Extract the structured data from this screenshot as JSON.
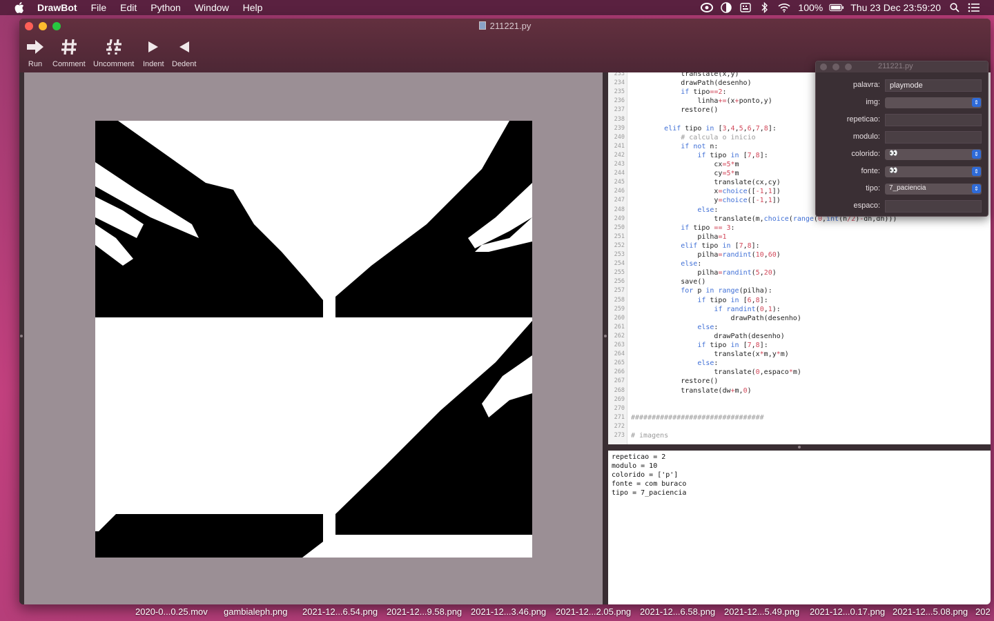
{
  "menubar": {
    "app": "DrawBot",
    "menus": [
      "File",
      "Edit",
      "Python",
      "Window",
      "Help"
    ],
    "battery": "100%",
    "clock": "Thu 23 Dec  23:59:20"
  },
  "window": {
    "title": "211221.py",
    "toolbar": [
      {
        "label": "Run",
        "icon": "run-arrow-icon"
      },
      {
        "label": "Comment",
        "icon": "hash-icon"
      },
      {
        "label": "Uncomment",
        "icon": "hash-broken-icon"
      },
      {
        "label": "Indent",
        "icon": "triangle-right-icon"
      },
      {
        "label": "Dedent",
        "icon": "triangle-left-icon"
      }
    ]
  },
  "editor": {
    "lines": [
      {
        "n": "233",
        "code": "            translate(x,y)"
      },
      {
        "n": "234",
        "code": "            drawPath(desenho)"
      },
      {
        "n": "235",
        "code": "            if tipo==2:"
      },
      {
        "n": "236",
        "code": "                linha+=(x+ponto,y)"
      },
      {
        "n": "237",
        "code": "            restore()"
      },
      {
        "n": "238",
        "code": ""
      },
      {
        "n": "239",
        "code": "        elif tipo in [3,4,5,6,7,8]:"
      },
      {
        "n": "240",
        "code": "            # calcula o inicio"
      },
      {
        "n": "241",
        "code": "            if not n:"
      },
      {
        "n": "242",
        "code": "                if tipo in [7,8]:"
      },
      {
        "n": "243",
        "code": "                    cx=5*m"
      },
      {
        "n": "244",
        "code": "                    cy=5*m"
      },
      {
        "n": "245",
        "code": "                    translate(cx,cy)"
      },
      {
        "n": "246",
        "code": "                    x=choice([-1,1])"
      },
      {
        "n": "247",
        "code": "                    y=choice([-1,1])"
      },
      {
        "n": "248",
        "code": "                else:"
      },
      {
        "n": "249",
        "code": "                    translate(m,choice(range(0,int(h/2)-dh,dh)))"
      },
      {
        "n": "250",
        "code": "            if tipo == 3:"
      },
      {
        "n": "251",
        "code": "                pilha=1"
      },
      {
        "n": "252",
        "code": "            elif tipo in [7,8]:"
      },
      {
        "n": "253",
        "code": "                pilha=randint(10,60)"
      },
      {
        "n": "254",
        "code": "            else:"
      },
      {
        "n": "255",
        "code": "                pilha=randint(5,20)"
      },
      {
        "n": "256",
        "code": "            save()"
      },
      {
        "n": "257",
        "code": "            for p in range(pilha):"
      },
      {
        "n": "258",
        "code": "                if tipo in [6,8]:"
      },
      {
        "n": "259",
        "code": "                    if randint(0,1):"
      },
      {
        "n": "260",
        "code": "                        drawPath(desenho)"
      },
      {
        "n": "261",
        "code": "                else:"
      },
      {
        "n": "262",
        "code": "                    drawPath(desenho)"
      },
      {
        "n": "263",
        "code": "                if tipo in [7,8]:"
      },
      {
        "n": "264",
        "code": "                    translate(x*m,y*m)"
      },
      {
        "n": "265",
        "code": "                else:"
      },
      {
        "n": "266",
        "code": "                    translate(0,espaco*m)"
      },
      {
        "n": "267",
        "code": "            restore()"
      },
      {
        "n": "268",
        "code": "            translate(dw+m,0)"
      },
      {
        "n": "269",
        "code": ""
      },
      {
        "n": "270",
        "code": ""
      },
      {
        "n": "271",
        "code": "################################"
      },
      {
        "n": "272",
        "code": ""
      },
      {
        "n": "273",
        "code": "# imagens"
      }
    ]
  },
  "output": {
    "lines": [
      "repeticao = 2",
      "modulo = 10",
      "colorido = ['p']",
      "fonte = com buraco",
      "tipo = 7_paciencia"
    ]
  },
  "variables": {
    "title": "211221.py",
    "rows": [
      {
        "label": "palavra:",
        "kind": "text",
        "value": "playmode"
      },
      {
        "label": "img:",
        "kind": "select",
        "value": ""
      },
      {
        "label": "repeticao:",
        "kind": "slider",
        "value": ""
      },
      {
        "label": "modulo:",
        "kind": "slider",
        "value": ""
      },
      {
        "label": "colorido:",
        "kind": "select",
        "value": "👀"
      },
      {
        "label": "fonte:",
        "kind": "select",
        "value": "👀"
      },
      {
        "label": "tipo:",
        "kind": "select",
        "value": "7_paciencia"
      },
      {
        "label": "espaco:",
        "kind": "slider",
        "value": ""
      }
    ]
  },
  "dock": {
    "files": [
      "2020-0...0.25.mov",
      "gambialeph.png",
      "2021-12...6.54.png",
      "2021-12...9.58.png",
      "2021-12...3.46.png",
      "2021-12...2.05.png",
      "2021-12...6.58.png",
      "2021-12...5.49.png",
      "2021-12...0.17.png",
      "2021-12...5.08.png",
      "202"
    ]
  },
  "colors": {
    "menubar": "#5a2140",
    "titlebar": "#63303f",
    "canvas_bg": "#9b8f95",
    "keyword": "#3f6fd6",
    "number": "#d2485a",
    "comment": "#9a9a9a",
    "select_accent": "#2f6bd8"
  }
}
